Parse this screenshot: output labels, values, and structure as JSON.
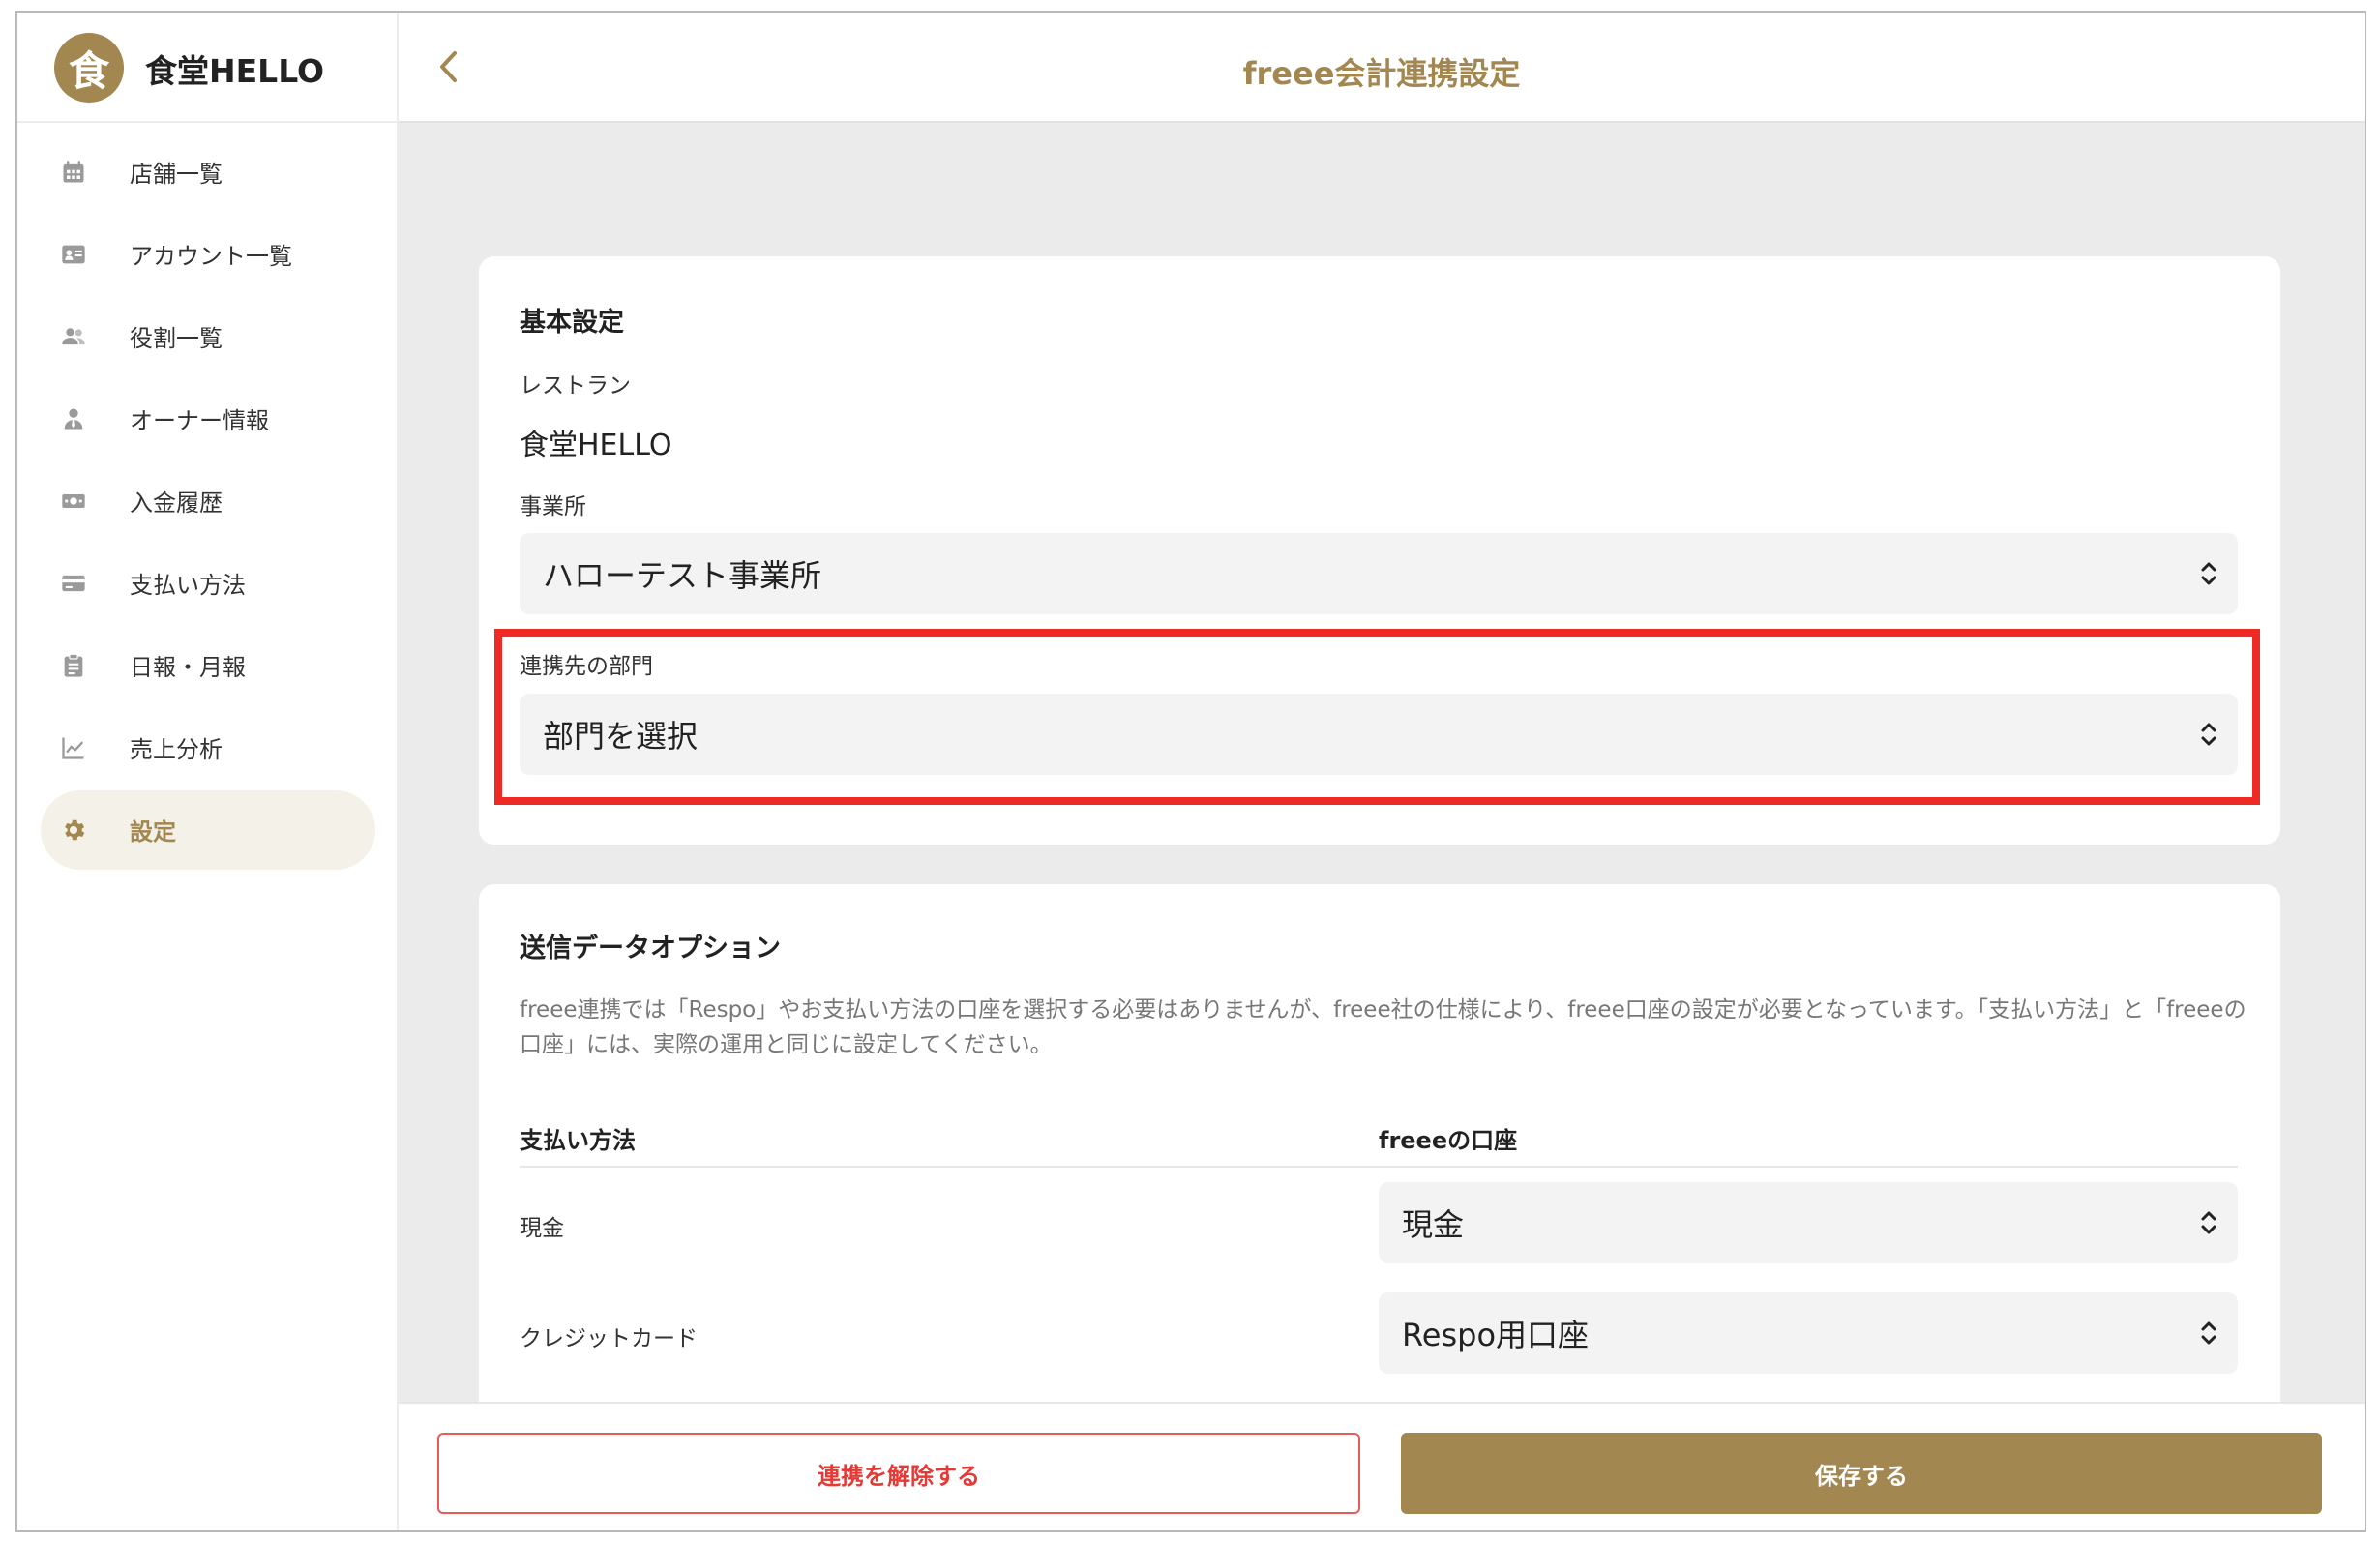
{
  "brand": {
    "logo_char": "食",
    "name": "食堂HELLO"
  },
  "sidebar": {
    "items": [
      {
        "label": "店舗一覧",
        "icon": "calendar-icon"
      },
      {
        "label": "アカウント一覧",
        "icon": "id-card-icon"
      },
      {
        "label": "役割一覧",
        "icon": "users-icon"
      },
      {
        "label": "オーナー情報",
        "icon": "owner-icon"
      },
      {
        "label": "入金履歴",
        "icon": "money-icon"
      },
      {
        "label": "支払い方法",
        "icon": "credit-card-icon"
      },
      {
        "label": "日報・月報",
        "icon": "clipboard-icon"
      },
      {
        "label": "売上分析",
        "icon": "line-chart-icon"
      },
      {
        "label": "設定",
        "icon": "gear-icon",
        "active": true
      }
    ]
  },
  "header": {
    "title": "freee会計連携設定"
  },
  "basic": {
    "title": "基本設定",
    "restaurant_label": "レストラン",
    "restaurant_value": "食堂HELLO",
    "office_label": "事業所",
    "office_value": "ハローテスト事業所",
    "department_label": "連携先の部門",
    "department_value": "部門を選択"
  },
  "options": {
    "title": "送信データオプション",
    "description": "freee連携では「Respo」やお支払い方法の口座を選択する必要はありませんが、freee社の仕様により、freee口座の設定が必要となっています。「支払い方法」と「freeeの口座」には、実際の運用と同じに設定してください。",
    "col_method": "支払い方法",
    "col_account": "freeeの口座",
    "rows": [
      {
        "method": "現金",
        "account": "現金"
      },
      {
        "method": "クレジットカード",
        "account": "Respo用口座"
      }
    ]
  },
  "footer": {
    "unlink_label": "連携を解除する",
    "save_label": "保存する"
  },
  "colors": {
    "accent": "#a38750",
    "danger": "#e53935",
    "highlight": "#ee2a24"
  }
}
